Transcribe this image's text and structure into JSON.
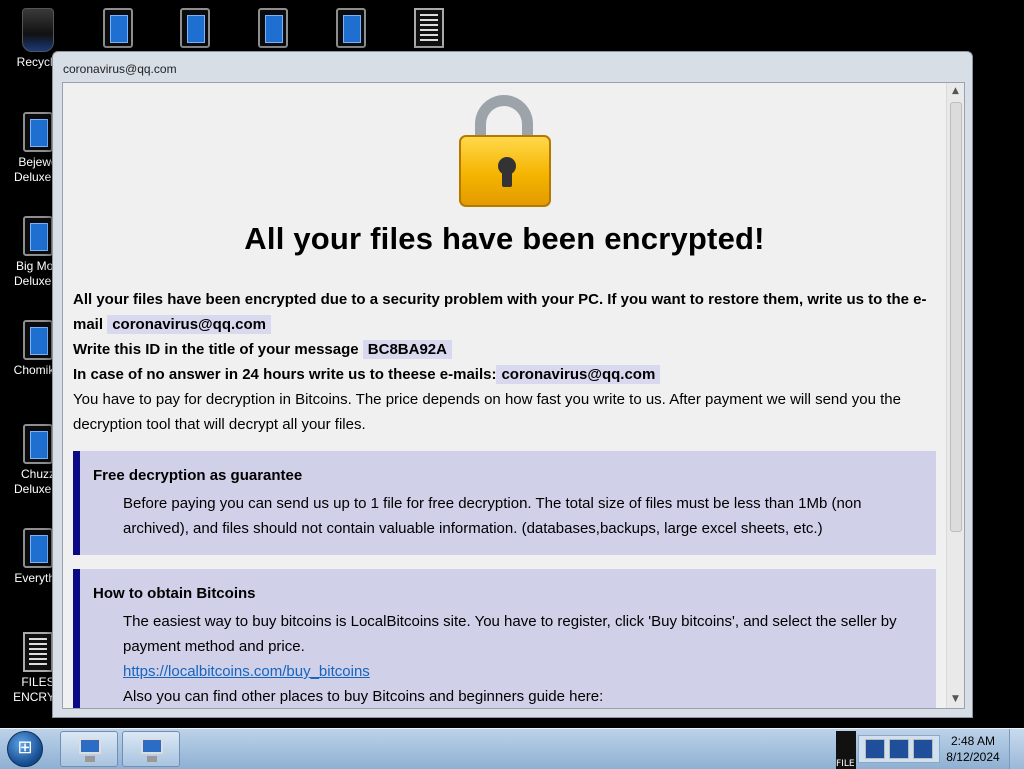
{
  "desktop": {
    "icons": [
      {
        "label": "Recycle"
      },
      {
        "label": "Bejewe\nDeluxe.Ir"
      },
      {
        "label": "Big Mon\nDeluxe.Ir"
      },
      {
        "label": "ChomikB"
      },
      {
        "label": "Chuzz\nDeluxe.Ir"
      },
      {
        "label": "Everythir"
      },
      {
        "label": "FILES\nENCRYP"
      }
    ]
  },
  "window": {
    "title": "coronavirus@qq.com",
    "heading": "All your files have been encrypted!",
    "intro": {
      "line1": "All your files have been encrypted due to a security problem with your PC. If you want to restore them, write us to the e-mail",
      "email1": "coronavirus@qq.com",
      "line2": "Write this ID in the title of your message",
      "id": "BC8BA92A",
      "line3": "In case of no answer in 24 hours write us to theese e-mails:",
      "email2": "coronavirus@qq.com",
      "line4": "You have to pay for decryption in Bitcoins. The price depends on how fast you write to us. After payment we will send you the decryption tool that will decrypt all your files."
    },
    "boxes": [
      {
        "title": "Free decryption as guarantee",
        "text": "Before paying you can send us up to 1 file for free decryption. The total size of files must be less than 1Mb (non archived), and files should not contain valuable information. (databases,backups, large excel sheets, etc.)"
      },
      {
        "title": "How to obtain Bitcoins",
        "text": "The easiest way to buy bitcoins is LocalBitcoins site. You have to register, click 'Buy bitcoins', and select the seller by payment method and price.",
        "link": "https://localbitcoins.com/buy_bitcoins",
        "text2": "Also you can find other places to buy Bitcoins and beginners guide here:"
      }
    ]
  },
  "taskbar": {
    "tray_file_label": "FILE",
    "clock_time": "2:48 AM",
    "clock_date": "8/12/2024"
  },
  "colors": {
    "box_bg": "#d0d0e8",
    "box_border": "#0a0a85",
    "highlight_bg": "#d8d8ef",
    "link": "#1565c0"
  }
}
